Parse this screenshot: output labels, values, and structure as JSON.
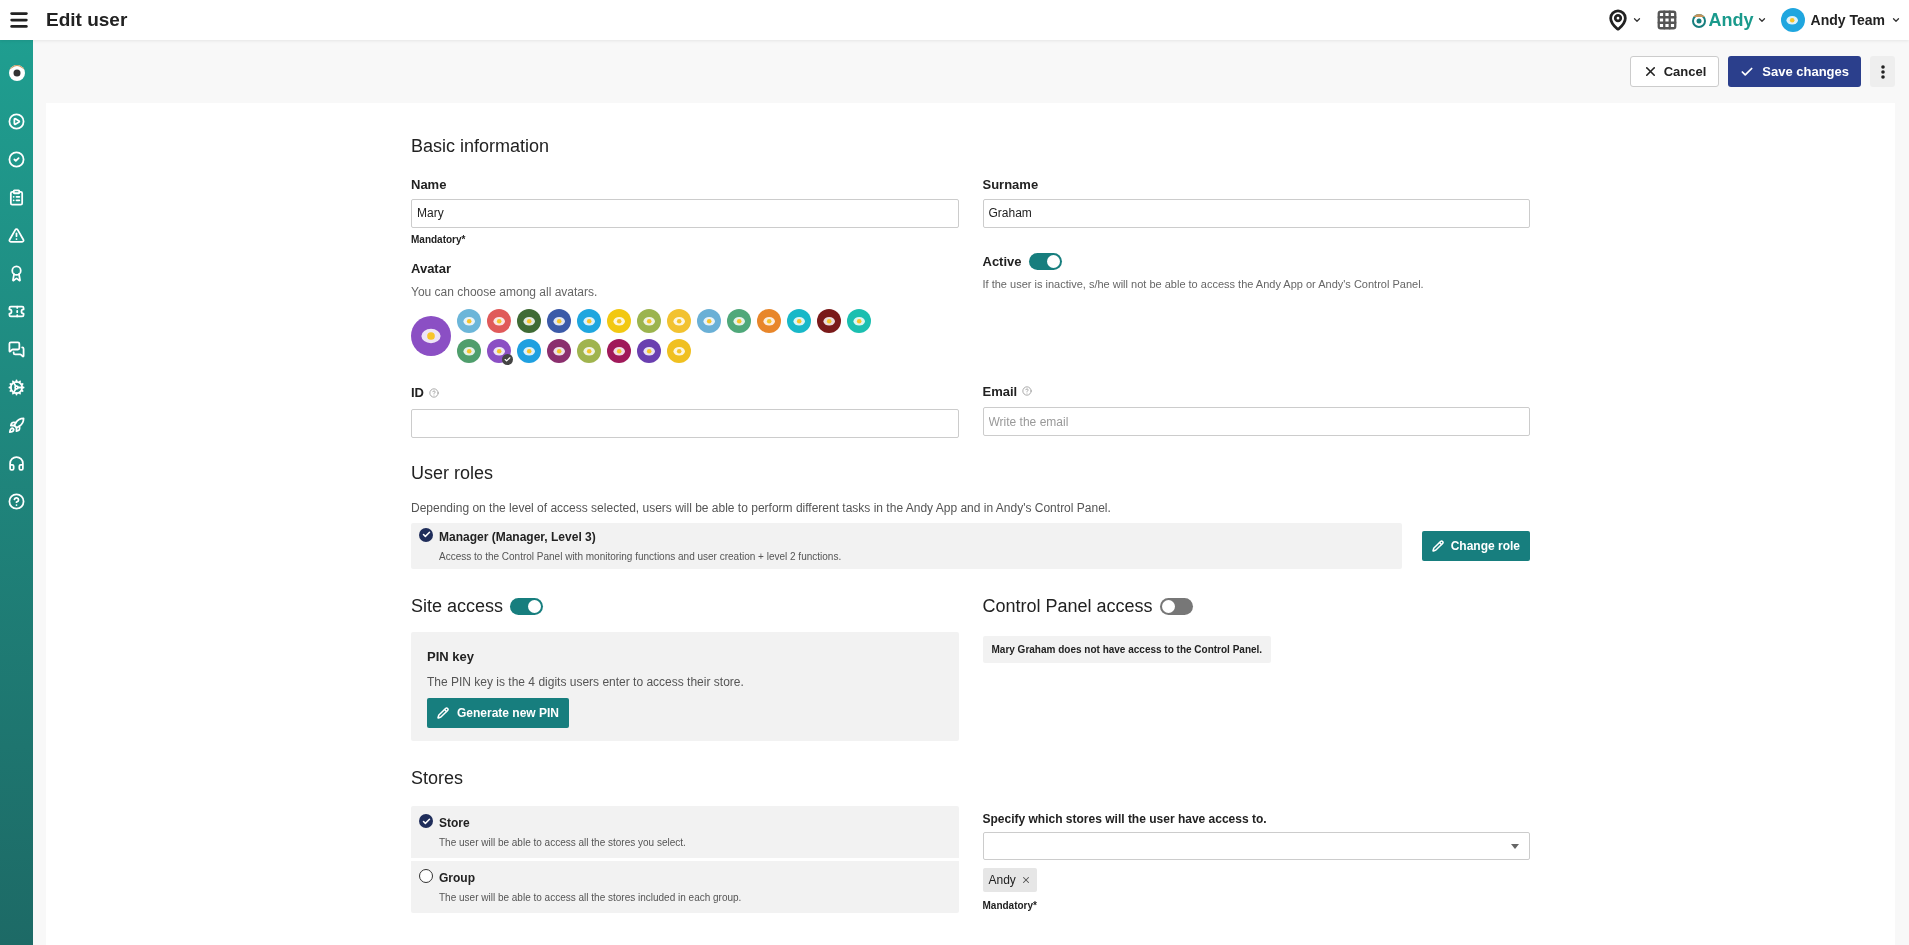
{
  "header": {
    "title": "Edit user",
    "brand": "Andy",
    "account": "Andy Team"
  },
  "actions": {
    "cancel": "Cancel",
    "save": "Save changes"
  },
  "basic": {
    "heading": "Basic information",
    "name": {
      "label": "Name",
      "value": "Mary",
      "hint": "Mandatory*"
    },
    "surname": {
      "label": "Surname",
      "value": "Graham"
    },
    "avatar": {
      "label": "Avatar",
      "description": "You can choose among all avatars.",
      "options": [
        {
          "color": "#6cb6d9",
          "selected": false
        },
        {
          "color": "#e05a5a",
          "selected": false
        },
        {
          "color": "#3f6b35",
          "selected": false
        },
        {
          "color": "#3b5aa8",
          "selected": false
        },
        {
          "color": "#1fa6df",
          "selected": false
        },
        {
          "color": "#f2c811",
          "selected": false
        },
        {
          "color": "#9bb44e",
          "selected": false
        },
        {
          "color": "#f2c230",
          "selected": false
        },
        {
          "color": "#6ab0d6",
          "selected": false
        },
        {
          "color": "#4fa87a",
          "selected": false
        },
        {
          "color": "#e8862a",
          "selected": false
        },
        {
          "color": "#18b8c8",
          "selected": false
        },
        {
          "color": "#7a1a1a",
          "selected": false
        },
        {
          "color": "#1bbfb0",
          "selected": false
        },
        {
          "color": "#4f9e6c",
          "selected": false
        },
        {
          "color": "#8b4fc4",
          "selected": true
        },
        {
          "color": "#1fa0e0",
          "selected": false
        },
        {
          "color": "#8b2f6e",
          "selected": false
        },
        {
          "color": "#a0b44e",
          "selected": false
        },
        {
          "color": "#a0195a",
          "selected": false
        },
        {
          "color": "#6a3fb0",
          "selected": false
        },
        {
          "color": "#f0c020",
          "selected": false
        }
      ]
    },
    "active": {
      "label": "Active",
      "on": true,
      "description": "If the user is inactive, s/he will not be able to access the Andy App or Andy's Control Panel."
    },
    "id": {
      "label": "ID"
    },
    "email": {
      "label": "Email",
      "placeholder": "Write the email"
    }
  },
  "roles": {
    "heading": "User roles",
    "description": "Depending on the level of access selected, users will be able to perform different tasks in the Andy App and in Andy's Control Panel.",
    "role": {
      "title": "Manager (Manager, Level 3)",
      "description": "Access to the Control Panel with monitoring functions and user creation + level 2 functions.",
      "checked": true
    },
    "change_button": "Change role"
  },
  "site_access": {
    "label": "Site access",
    "on": true,
    "pin": {
      "title": "PIN key",
      "description": "The PIN key is the 4 digits users enter to access their store.",
      "button": "Generate new PIN"
    }
  },
  "control_panel": {
    "label": "Control Panel access",
    "on": false,
    "notice": "Mary Graham does not have access to the Control Panel."
  },
  "stores": {
    "heading": "Stores",
    "options": [
      {
        "title": "Store",
        "description": "The user will be able to access all the stores you select.",
        "selected": true
      },
      {
        "title": "Group",
        "description": "The user will be able to access all the stores included in each group.",
        "selected": false
      }
    ],
    "select_label": "Specify which stores will the user have access to.",
    "chips": [
      "Andy"
    ],
    "hint": "Mandatory*"
  }
}
